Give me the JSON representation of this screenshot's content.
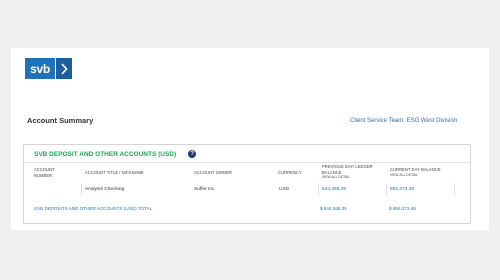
{
  "logo": {
    "text": "svb"
  },
  "page": {
    "title": "Account Summary",
    "team_label": "Client Service Team: ESG West Division"
  },
  "panel": {
    "heading": "SVB DEPOSIT AND OTHER ACCOUNTS (USD)",
    "help": "?",
    "columns": {
      "account_number": "ACCOUNT NUMBER",
      "title": "ACCOUNT TITLE / NICKNAME",
      "owner": "ACCOUNT OWNER",
      "currency": "CURRENCY",
      "prev_balance": "PREVIOUS DAY/ LEDGER BALANCE",
      "prev_view_all": "VIEW ALL DETAIL",
      "current_balance": "CURRENT DAY BALANCE",
      "current_view_all": "VIEW ALL DETAIL"
    },
    "rows": [
      {
        "account_number": "",
        "title": "Analysis Checking",
        "owner": "Suffer Inc",
        "currency": "USD",
        "prev_balance": "844,368.35",
        "current_balance": "855,373.48"
      }
    ],
    "total": {
      "label": "SVB DEPOSITS AND OTHER ACCOUNTS (USD) TOTAL",
      "prev_balance": "$ 844,368.35",
      "current_balance": "$ 855,373.48"
    }
  },
  "colors": {
    "brand_blue": "#1f72b8",
    "heading_green": "#1fa65a",
    "link_blue": "#2f6faa"
  }
}
